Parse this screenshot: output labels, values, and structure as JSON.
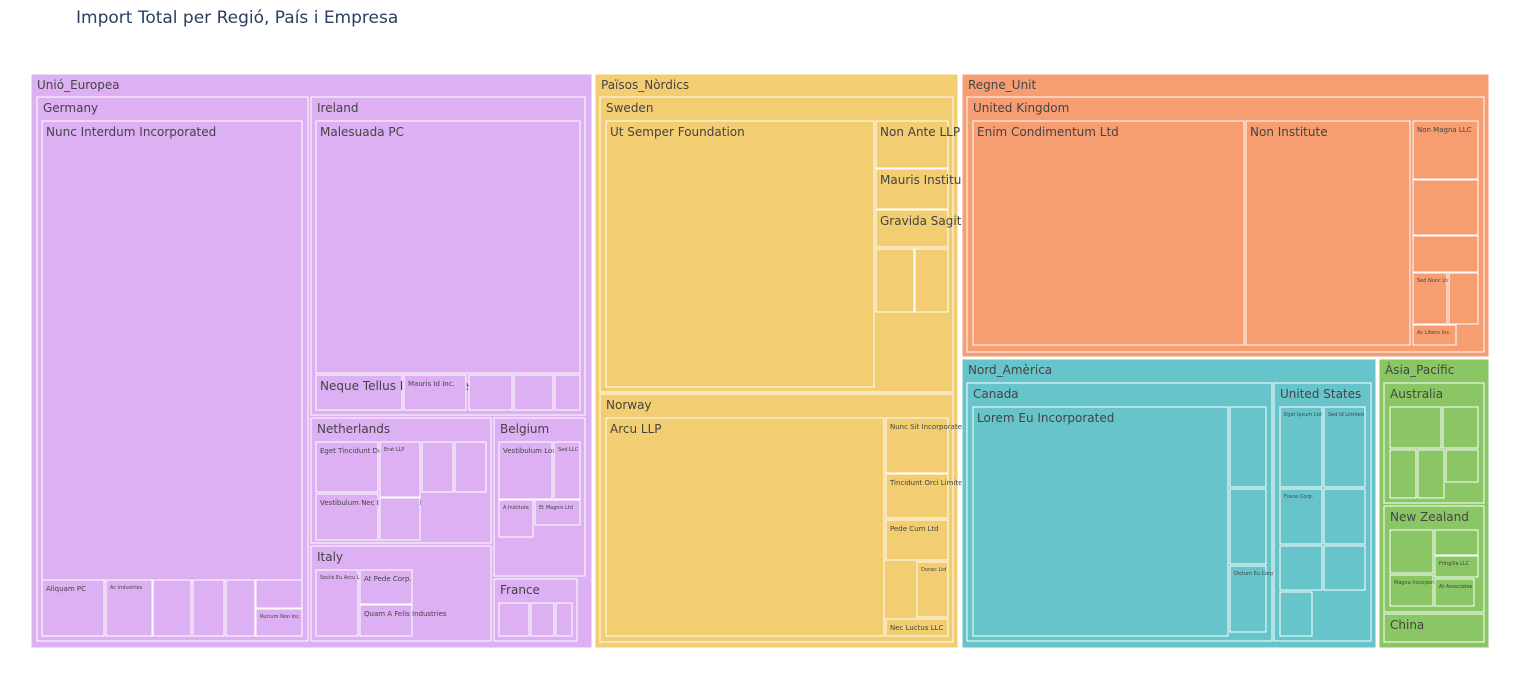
{
  "chart_data": {
    "type": "treemap",
    "title": "Import Total per Regió, País i Empresa",
    "level_colors": {
      "Unió_Europea": "#dcb0f2",
      "Països_Nòrdics": "#f2cd72",
      "Regne_Unit": "#f69d72",
      "Nord_Amèrica": "#67c4cb",
      "Àsia_Pacífic": "#8ac764"
    },
    "regions": [
      {
        "name": "Unió_Europea",
        "value": 100,
        "countries": [
          {
            "name": "Germany",
            "value": 49,
            "companies": [
              {
                "name": "Nunc Interdum Incorporated",
                "value": 37.0
              },
              {
                "name": "Aliquam PC",
                "value": 1.7
              },
              {
                "name": "Ac Industries",
                "value": 1.6
              },
              {
                "name": "",
                "value": 1.3
              },
              {
                "name": "",
                "value": 1.1
              },
              {
                "name": "",
                "value": 1.0
              },
              {
                "name": "",
                "value": 0.8
              },
              {
                "name": "Rutrum Non Inc.",
                "value": 0.8
              }
            ]
          },
          {
            "name": "Ireland",
            "value": 23,
            "companies": [
              {
                "name": "Malesuada PC",
                "value": 18.5
              },
              {
                "name": "Neque Tellus Incorporated",
                "value": 1.2
              },
              {
                "name": "Mauris Id Inc.",
                "value": 1.0
              },
              {
                "name": "",
                "value": 0.6
              },
              {
                "name": "",
                "value": 0.5
              },
              {
                "name": "",
                "value": 0.4
              }
            ]
          },
          {
            "name": "Netherlands",
            "value": 12,
            "companies": [
              {
                "name": "Eget Tincidunt Dui Institute",
                "value": 2.0
              },
              {
                "name": "Vestibulum Nec Incorporated",
                "value": 1.7
              },
              {
                "name": "Erat LLP",
                "value": 1.4
              },
              {
                "name": "",
                "value": 1.2
              },
              {
                "name": "",
                "value": 1.0
              },
              {
                "name": "",
                "value": 0.9
              }
            ]
          },
          {
            "name": "Belgium",
            "value": 6,
            "companies": [
              {
                "name": "Vestibulum Lorem PC",
                "value": 1.4
              },
              {
                "name": "Sed LLC",
                "value": 0.7
              },
              {
                "name": "A Institute",
                "value": 0.6
              },
              {
                "name": "Et Magnis Ltd",
                "value": 0.6
              }
            ]
          },
          {
            "name": "Italy",
            "value": 7,
            "companies": [
              {
                "name": "Sociis Eu Arcu Ltd",
                "value": 1.6
              },
              {
                "name": "At Pede Corp.",
                "value": 1.0
              },
              {
                "name": "Quam A Felis Industries",
                "value": 0.8
              }
            ]
          },
          {
            "name": "France",
            "value": 3,
            "companies": [
              {
                "name": "",
                "value": 1.0
              },
              {
                "name": "",
                "value": 0.8
              },
              {
                "name": "",
                "value": 0.6
              }
            ]
          }
        ]
      },
      {
        "name": "Països_Nòrdics",
        "value": 64,
        "countries": [
          {
            "name": "Sweden",
            "value": 36,
            "companies": [
              {
                "name": "Ut Semper Foundation",
                "value": 27.0
              },
              {
                "name": "Non Ante LLP",
                "value": 2.0
              },
              {
                "name": "Mauris Institute",
                "value": 1.9
              },
              {
                "name": "Gravida Sagittis LLP",
                "value": 1.5
              },
              {
                "name": "",
                "value": 1.2
              },
              {
                "name": "",
                "value": 1.0
              }
            ]
          },
          {
            "name": "Norway",
            "value": 28,
            "companies": [
              {
                "name": "Arcu LLP",
                "value": 21.0
              },
              {
                "name": "Nunc Sit Incorporated",
                "value": 1.9
              },
              {
                "name": "Tincidunt Orci Limited",
                "value": 1.6
              },
              {
                "name": "Pede Cum Ltd",
                "value": 1.4
              },
              {
                "name": "Donec Ltd",
                "value": 1.1
              },
              {
                "name": "Nec Luctus LLC",
                "value": 0.6
              }
            ]
          }
        ]
      },
      {
        "name": "Regne_Unit",
        "value": 45,
        "countries": [
          {
            "name": "United Kingdom",
            "value": 45,
            "companies": [
              {
                "name": "Enim Condimentum Ltd",
                "value": 23.0
              },
              {
                "name": "Non Institute",
                "value": 14.0
              },
              {
                "name": "Non Magna LLC",
                "value": 2.0
              },
              {
                "name": "",
                "value": 2.0
              },
              {
                "name": "",
                "value": 1.2
              },
              {
                "name": "Sed Nunc Ltd",
                "value": 1.3
              },
              {
                "name": "",
                "value": 1.0
              },
              {
                "name": "Ac Libero Inc.",
                "value": 0.6
              }
            ]
          }
        ]
      },
      {
        "name": "Nord_Amèrica",
        "value": 38,
        "countries": [
          {
            "name": "Canada",
            "value": 27,
            "companies": [
              {
                "name": "Lorem Eu Incorporated",
                "value": 23.0
              },
              {
                "name": "",
                "value": 1.6
              },
              {
                "name": "",
                "value": 1.3
              },
              {
                "name": "Dictum Eu Corp.",
                "value": 1.1
              }
            ]
          },
          {
            "name": "United States",
            "value": 11,
            "companies": [
              {
                "name": "Eget Ipsum Ltd",
                "value": 2.4
              },
              {
                "name": "Sed Id Limited",
                "value": 2.4
              },
              {
                "name": "Fusce Corp.",
                "value": 1.5
              },
              {
                "name": "",
                "value": 1.3
              },
              {
                "name": "",
                "value": 1.2
              },
              {
                "name": "",
                "value": 1.2
              },
              {
                "name": "",
                "value": 0.6
              }
            ]
          }
        ]
      },
      {
        "name": "Àsia_Pacífic",
        "value": 10,
        "countries": [
          {
            "name": "Australia",
            "value": 5,
            "companies": [
              {
                "name": "",
                "value": 1.2
              },
              {
                "name": "",
                "value": 1.2
              },
              {
                "name": "",
                "value": 1.0
              },
              {
                "name": "",
                "value": 0.8
              },
              {
                "name": "",
                "value": 0.6
              }
            ]
          },
          {
            "name": "New Zealand",
            "value": 4.3,
            "companies": [
              {
                "name": "",
                "value": 1.3
              },
              {
                "name": "",
                "value": 0.6
              },
              {
                "name": "Fringilla LLC",
                "value": 0.6
              },
              {
                "name": "Magna Incorporated",
                "value": 1.0
              },
              {
                "name": "At Associates",
                "value": 0.6
              }
            ]
          },
          {
            "name": "China",
            "value": 1.0,
            "companies": []
          }
        ]
      }
    ]
  }
}
